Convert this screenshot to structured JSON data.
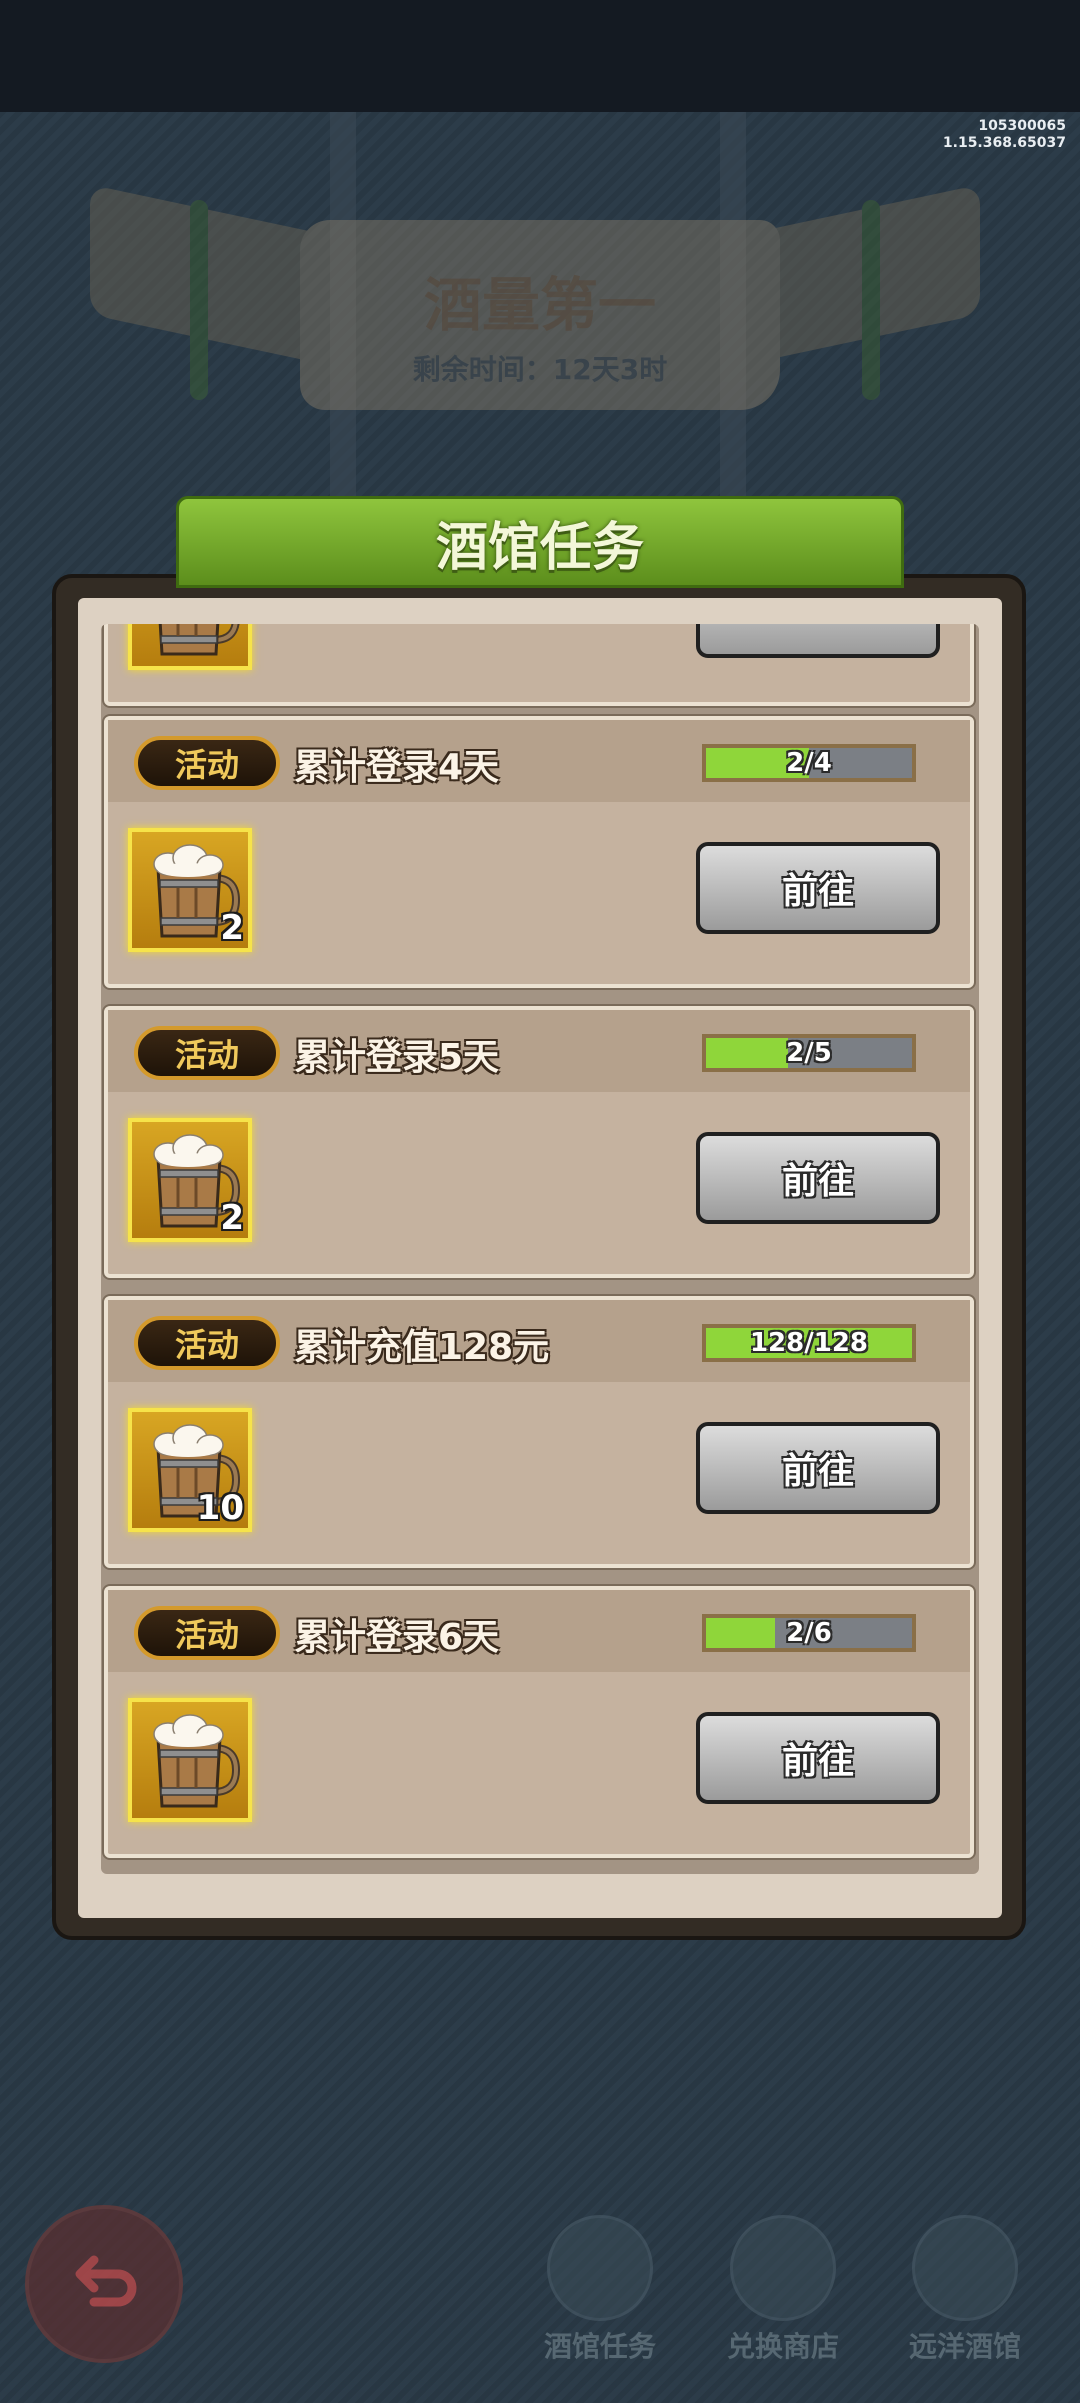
{
  "version": {
    "build": "105300065",
    "client": "1.15.368.65037"
  },
  "background": {
    "event_title": "酒量第一",
    "remaining_time": "剩余时间：12天3时",
    "nav": [
      {
        "label": "酒馆任务",
        "icon": "tavern-task-icon"
      },
      {
        "label": "兑换商店",
        "icon": "exchange-shop-icon"
      },
      {
        "label": "远洋酒馆",
        "icon": "ocean-tavern-icon"
      }
    ]
  },
  "panel": {
    "title": "酒馆任务"
  },
  "tasks": [
    {
      "tag": "活动",
      "title": "累计登录4天",
      "progress_text": "2/4",
      "progress": 0.5,
      "reward_icon": "beer-mug-icon",
      "reward_qty": "2",
      "button": "前往"
    },
    {
      "tag": "活动",
      "title": "累计登录5天",
      "progress_text": "2/5",
      "progress": 0.4,
      "reward_icon": "beer-mug-icon",
      "reward_qty": "2",
      "button": "前往"
    },
    {
      "tag": "活动",
      "title": "累计充值128元",
      "progress_text": "128/128",
      "progress": 1.0,
      "reward_icon": "beer-mug-icon",
      "reward_qty": "10",
      "button": "前往"
    },
    {
      "tag": "活动",
      "title": "累计登录6天",
      "progress_text": "2/6",
      "progress": 0.333,
      "reward_icon": "beer-mug-icon",
      "reward_qty": "",
      "button": "前往"
    }
  ],
  "colors": {
    "accent_green": "#8fd63a",
    "badge_gold": "#d49a2c",
    "panel_header": "#7bb22e"
  }
}
